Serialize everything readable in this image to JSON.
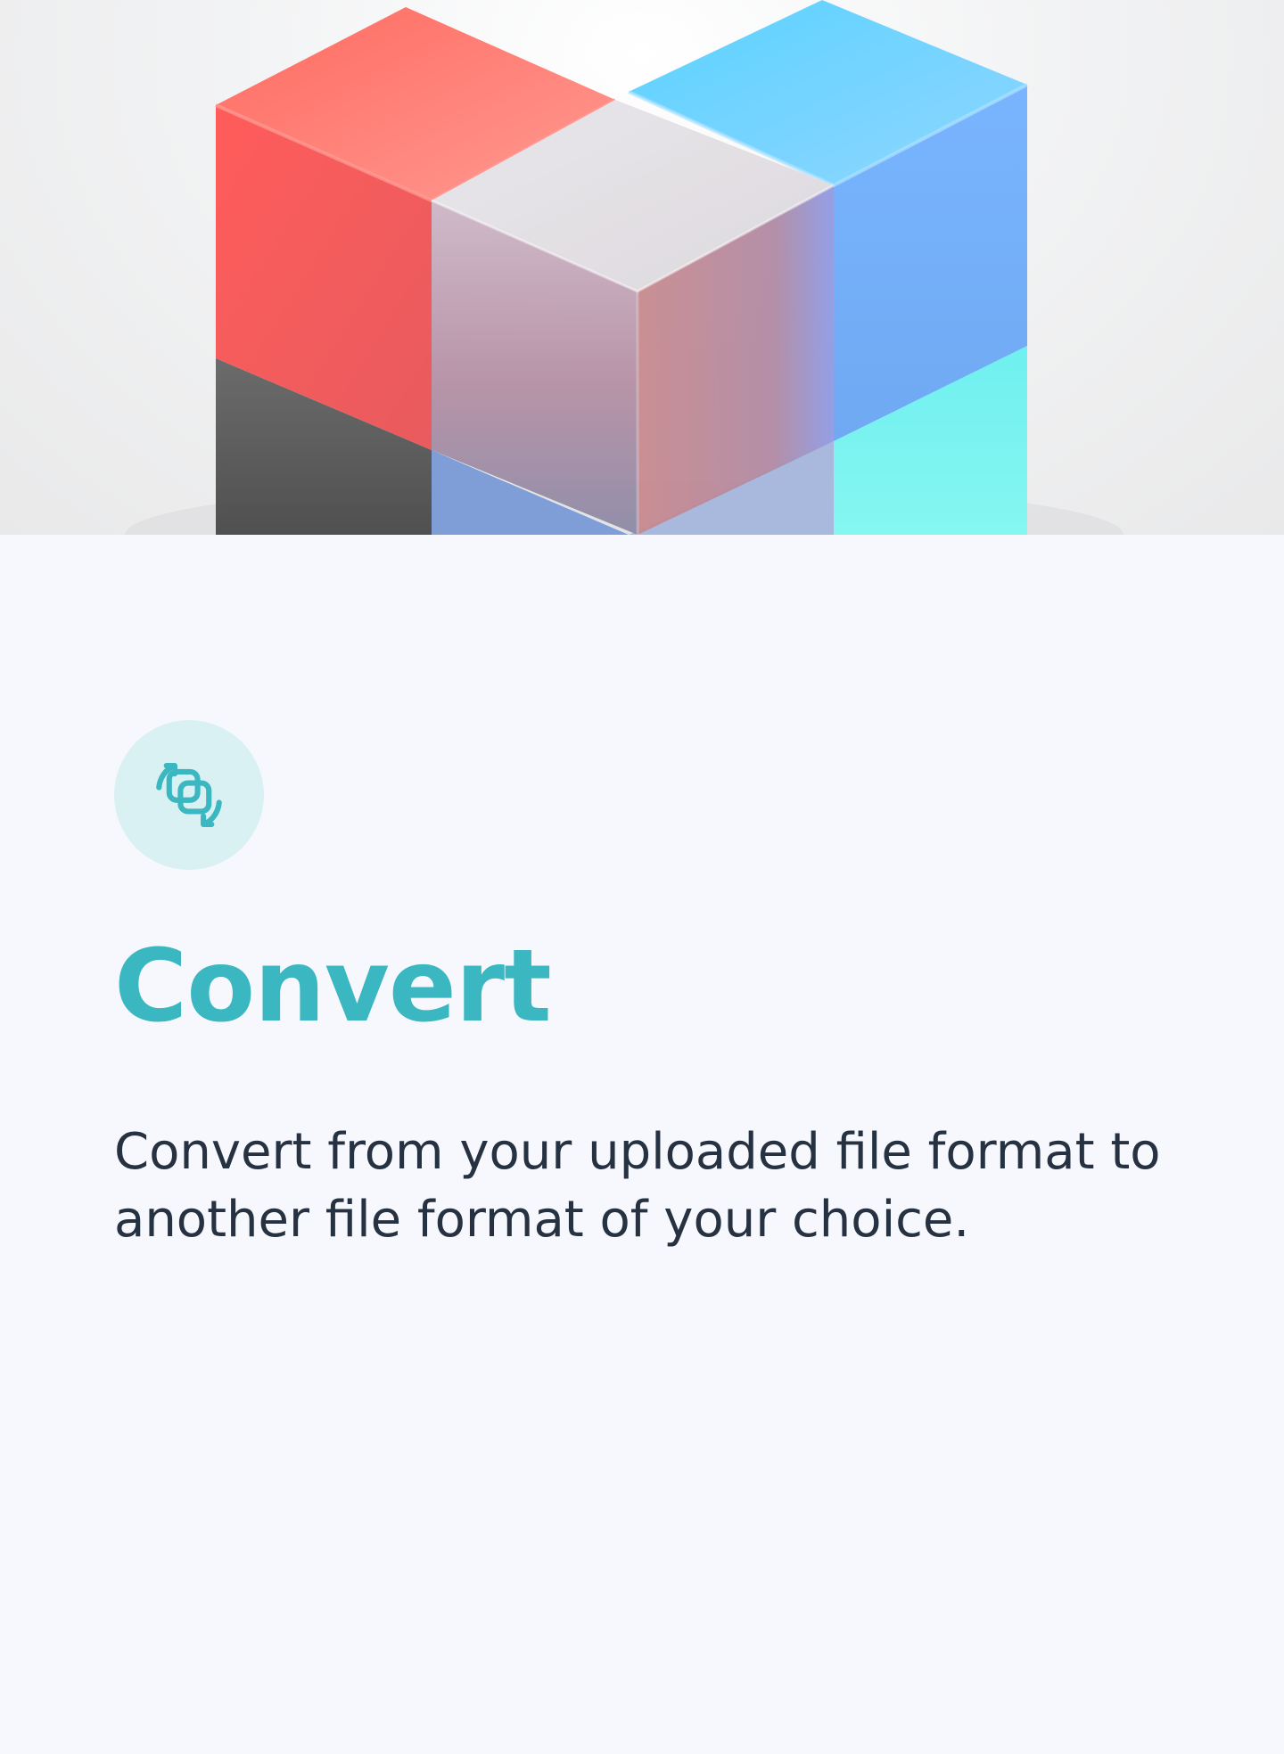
{
  "hero": {
    "image": "glass-cubes-illustration"
  },
  "feature": {
    "icon": "convert-icon",
    "title": "Convert",
    "description": "Convert from your uploaded file format to another file format of your choice."
  },
  "colors": {
    "accent": "#3bb7c1",
    "accent_bg": "#d9f1f2",
    "text": "#263241",
    "background": "#f7f8fd"
  }
}
